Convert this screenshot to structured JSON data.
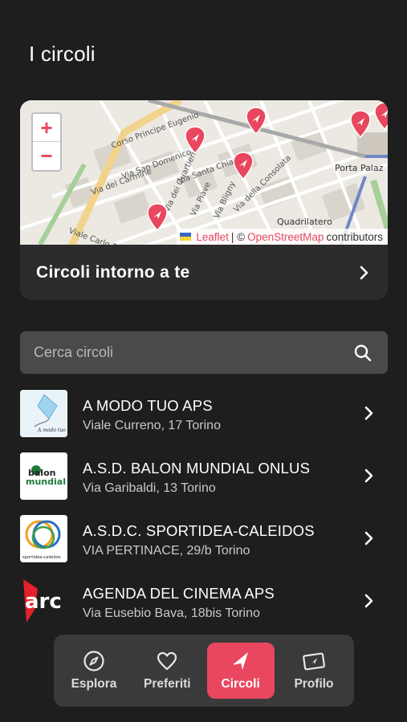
{
  "page": {
    "title": "I circoli"
  },
  "map": {
    "zoom_in": "+",
    "zoom_out": "−",
    "street_labels": [
      "Corso Principe Eugenio",
      "Via San Domenico",
      "Via Santa Chiara",
      "Via del Carmine",
      "Via dei Quartieri",
      "Via Piave",
      "Via Bligny",
      "Via della Consolata",
      "Viale Carlo Bouc",
      "Quadrilatero",
      "Porta Palaz"
    ],
    "attribution": {
      "leaflet": "Leaflet",
      "separator": "| ©",
      "osm": "OpenStreetMap",
      "suffix": "contributors"
    },
    "footer_label": "Circoli intorno a te",
    "colors": {
      "pin": "#e8475f",
      "map_bg": "#ece9e3"
    }
  },
  "search": {
    "placeholder": "Cerca circoli",
    "value": "",
    "icon": "search-icon"
  },
  "circoli": [
    {
      "name": "A MODO TUO APS",
      "address": "Viale Curreno, 17 Torino",
      "logo": "kite-logo"
    },
    {
      "name": "A.S.D. BALON MUNDIAL ONLUS",
      "address": "Via Garibaldi, 13 Torino",
      "logo": "balon-mundial-logo"
    },
    {
      "name": "A.S.D.C. SPORTIDEA-CALEIDOS",
      "address": "VIA PERTINACE, 29/b Torino",
      "logo": "rings-logo"
    },
    {
      "name": "AGENDA DEL CINEMA APS",
      "address": "Via Eusebio Bava, 18bis Torino",
      "logo": "arci-logo"
    }
  ],
  "logo_text": {
    "kite": "A modo tuo",
    "balon_top": "balon",
    "balon_bottom": "mundial",
    "rings": "sportidea-caleidos",
    "arci": "arc"
  },
  "nav": {
    "items": [
      {
        "label": "Esplora",
        "icon": "compass-icon"
      },
      {
        "label": "Preferiti",
        "icon": "heart-icon"
      },
      {
        "label": "Circoli",
        "icon": "star-flag-icon",
        "active": true
      },
      {
        "label": "Profilo",
        "icon": "ticket-icon"
      }
    ]
  },
  "colors": {
    "accent": "#e8475f",
    "background": "#1e1e1e",
    "card": "#2c2c2c",
    "nav": "#3a3a3a"
  }
}
